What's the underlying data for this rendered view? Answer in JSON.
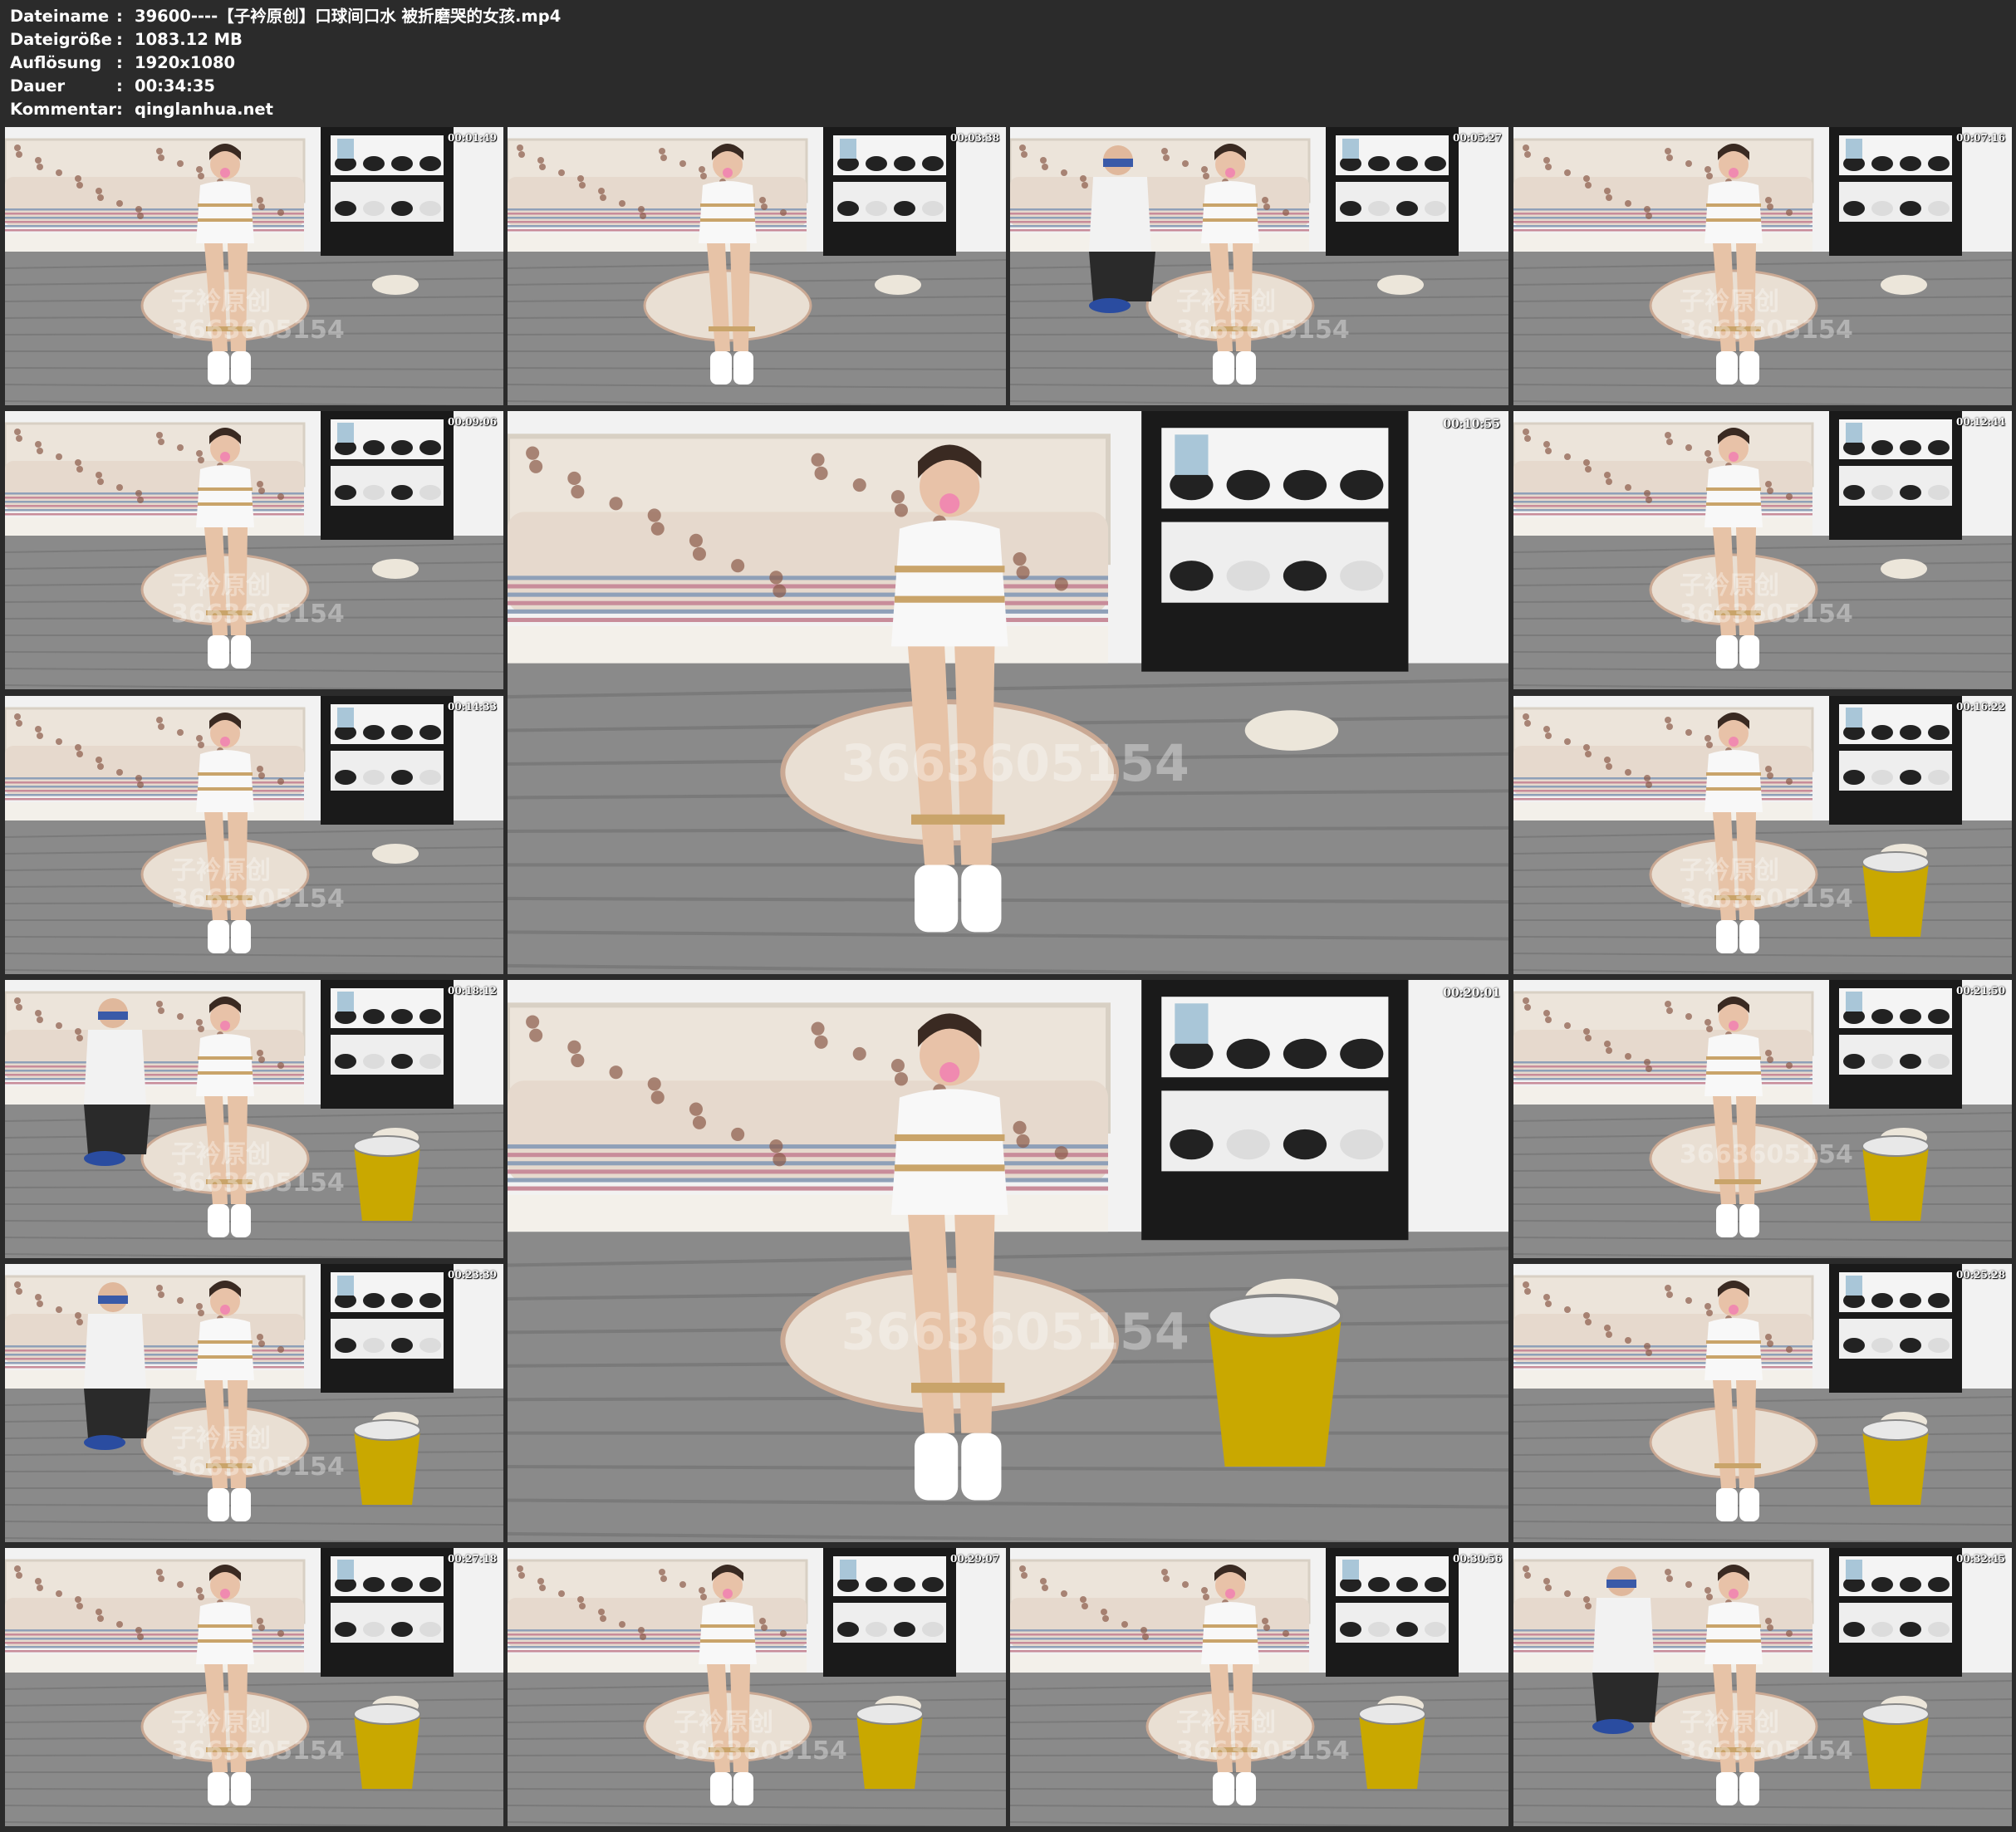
{
  "header": {
    "rows": [
      {
        "key": "Dateiname",
        "sep": ":",
        "value": "39600----【子衿原创】口球间口水 被折磨哭的女孩.mp4"
      },
      {
        "key": "Dateigröße",
        "sep": ":",
        "value": "1083.12 MB"
      },
      {
        "key": "Auflösung",
        "sep": ":",
        "value": "1920x1080"
      },
      {
        "key": "Dauer",
        "sep": ":",
        "value": "00:34:35"
      },
      {
        "key": "Kommentar",
        "sep": ":",
        "value": "qinglanhua.net"
      }
    ]
  },
  "thumbnails": [
    {
      "timestamp": "00:01:49",
      "watermark": "子衿原创 3663605154",
      "bucket": false,
      "helper": false
    },
    {
      "timestamp": "00:03:38",
      "watermark": "",
      "bucket": false,
      "helper": false
    },
    {
      "timestamp": "00:05:27",
      "watermark": "子衿原创 3663605154",
      "bucket": false,
      "helper": true
    },
    {
      "timestamp": "00:07:16",
      "watermark": "子衿原创 3663605154",
      "bucket": false,
      "helper": false
    },
    {
      "timestamp": "00:09:06",
      "watermark": "子衿原创 3663605154",
      "bucket": false,
      "helper": false
    },
    {
      "timestamp": "00:10:55",
      "watermark": "3663605154",
      "bucket": false,
      "helper": false
    },
    {
      "timestamp": "00:12:44",
      "watermark": "子衿原创 3663605154",
      "bucket": false,
      "helper": false
    },
    {
      "timestamp": "00:14:33",
      "watermark": "子衿原创 3663605154",
      "bucket": false,
      "helper": false
    },
    {
      "timestamp": "00:16:22",
      "watermark": "子衿原创 3663605154",
      "bucket": true,
      "helper": false
    },
    {
      "timestamp": "00:18:12",
      "watermark": "子衿原创 3663605154",
      "bucket": true,
      "helper": true
    },
    {
      "timestamp": "00:20:01",
      "watermark": "3663605154",
      "bucket": true,
      "helper": false
    },
    {
      "timestamp": "00:21:50",
      "watermark": "3663605154",
      "bucket": true,
      "helper": false
    },
    {
      "timestamp": "00:23:39",
      "watermark": "子衿原创 3663605154",
      "bucket": true,
      "helper": true
    },
    {
      "timestamp": "00:25:28",
      "watermark": "",
      "bucket": true,
      "helper": false
    },
    {
      "timestamp": "00:27:18",
      "watermark": "子衿原创 3663605154",
      "bucket": true,
      "helper": false
    },
    {
      "timestamp": "00:29:07",
      "watermark": "子衿原创 3663605154",
      "bucket": true,
      "helper": false
    },
    {
      "timestamp": "00:30:56",
      "watermark": "子衿原创 3663605154",
      "bucket": true,
      "helper": false
    },
    {
      "timestamp": "00:32:45",
      "watermark": "子衿原创 3663605154",
      "bucket": true,
      "helper": true
    }
  ],
  "colors": {
    "background": "#2b2b2b",
    "header_text": "#ffffff",
    "floor": "#8a8a8a",
    "wall": "#f2f2f2",
    "shelf": "#1a1a1a",
    "bucket": "#c9a800"
  }
}
